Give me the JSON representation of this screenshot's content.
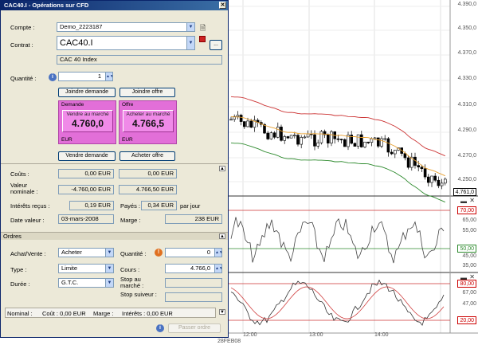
{
  "window": {
    "title": "CAC40.I - Opérations sur CFD",
    "close": "✕"
  },
  "form": {
    "compte_label": "Compte :",
    "compte_value": "Demo_2223187",
    "contrat_label": "Contrat :",
    "contrat_value": "CAC40.I",
    "contrat_desc": "CAC 40 Index",
    "contrat_more": "...",
    "quantite_label": "Quantité :",
    "quantite_value": "1",
    "joindre_demande": "Joindre demande",
    "joindre_offre": "Joindre offre",
    "vendre_demande": "Vendre demande",
    "acheter_offre": "Acheter offre",
    "couts_label": "Coûts :",
    "couts_demande": "0,00 EUR",
    "couts_offre": "0,00 EUR",
    "valeur_label": "Valeur nominale :",
    "valeur_demande": "-4.760,00 EUR",
    "valeur_offre": "4.766,50 EUR",
    "interets_recus_label": "Intérêts reçus :",
    "interets_recus_value": "0,19 EUR",
    "payes_label": "Payés :",
    "payes_value": "0,34 EUR",
    "par_jour": "par jour",
    "date_valeur_label": "Date valeur :",
    "date_valeur_value": "03-mars-2008",
    "marge_label": "Marge :",
    "marge_value": "238 EUR"
  },
  "quotes": {
    "demande": {
      "label": "Demande",
      "action": "Vendre au marché",
      "price": "4.760,0",
      "currency": "EUR"
    },
    "offre": {
      "label": "Offre",
      "action": "Acheter au marché",
      "price": "4.766,5",
      "currency": "EUR"
    }
  },
  "ordres": {
    "header": "Ordres",
    "achat_label": "Achat/Vente :",
    "achat_value": "Acheter",
    "type_label": "Type :",
    "type_value": "Limite",
    "duree_label": "Durée :",
    "duree_value": "G.T.C.",
    "quantite_label": "Quantité :",
    "quantite_value": "0",
    "cours_label": "Cours :",
    "cours_value": "4.766,0",
    "stop_label": "Stop au marché :",
    "stop_suiveur_label": "Stop suiveur :",
    "nominal_label": "Nominal :",
    "cout_label": "Coût : 0,00 EUR",
    "marge_label": "Marge :",
    "interets_label": "Intérêts : 0,00 EUR",
    "passer_ordre": "Passer ordre"
  },
  "chart": {
    "price_labels": [
      "4.390,0",
      "4.350,0",
      "4.370,0",
      "4.330,0",
      "4.310,0",
      "4.290,0",
      "4.270,0",
      "4.250,0",
      "4.230,0"
    ],
    "last_price": "4.761,0",
    "osc1_top": "70,00",
    "osc1_mid": "50,00",
    "osc1_labels": [
      "65,00",
      "55,00",
      "45,00",
      "35,00"
    ],
    "osc2_top": "80,00",
    "osc2_bottom": "20,00",
    "osc2_labels": [
      "67,00",
      "47,00"
    ],
    "x_labels": [
      "12:00",
      "13:00",
      "14:00"
    ],
    "date_label": "28FEB08",
    "colors": {
      "upper_band": "#cc3333",
      "lower_band": "#2d8a2d",
      "ma": "#e8a030",
      "candle": "#000000"
    }
  }
}
